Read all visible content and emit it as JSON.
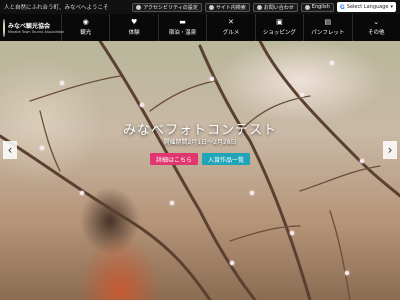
{
  "topbar": {
    "tagline": "人と自然にふれ合う町、みなべへようこそ",
    "utility_links": [
      {
        "label": "アクセシビリティの設定",
        "icon": "accessibility-icon"
      },
      {
        "label": "サイト内検索",
        "icon": "search-icon"
      },
      {
        "label": "お問い合わせ",
        "icon": "mail-icon"
      },
      {
        "label": "English",
        "icon": "globe-icon"
      }
    ],
    "language_select": "Select Language"
  },
  "logo": {
    "name": "みなべ観光協会",
    "subtitle": "Minabe Town Tourist Association"
  },
  "nav": [
    {
      "label": "観光",
      "icon": "camera-icon",
      "glyph": "◉"
    },
    {
      "label": "体験",
      "icon": "heart-icon",
      "glyph": "♥"
    },
    {
      "label": "宿泊・温泉",
      "icon": "bed-icon",
      "glyph": "▬"
    },
    {
      "label": "グルメ",
      "icon": "fork-knife-icon",
      "glyph": "✕"
    },
    {
      "label": "ショッピング",
      "icon": "bag-icon",
      "glyph": "▣"
    },
    {
      "label": "パンフレット",
      "icon": "book-icon",
      "glyph": "▤"
    },
    {
      "label": "その他",
      "icon": "chevron-circle-icon",
      "glyph": "⌄"
    }
  ],
  "hero": {
    "title": "みなべフォトコンテスト",
    "subtitle": "開催期間2月1日～2月28日",
    "buttons": {
      "detail": "詳細はこちら",
      "winners": "入賞作品一覧"
    },
    "prev_glyph": "‹",
    "next_glyph": "›"
  },
  "colors": {
    "detail_button": "#e0356f",
    "winners_button": "#20a4b8",
    "nav_background": "#000000"
  }
}
